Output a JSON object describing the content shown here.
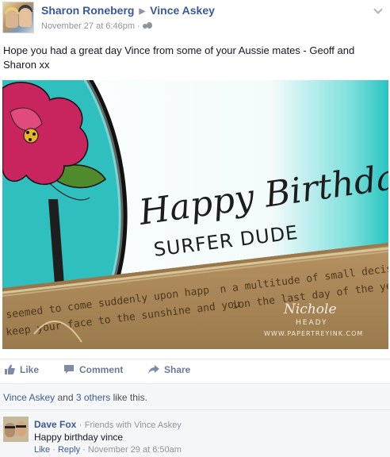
{
  "post": {
    "author": "Sharon Roneberg",
    "target": "Vince Askey",
    "timestamp": "November 27 at 6:46pm",
    "separator": "·",
    "text": "Hope you had a great day Vince from some of your Aussie mates - Geoff and Sharon xx"
  },
  "photo": {
    "card_line1": "Happy Birthday",
    "card_line2": "SURFER DUDE",
    "paper_text": [
      "seemed to come suddenly upon happ",
      "keep your face to the sunshine and you",
      "n a multitude of small decisions",
      "ion the last day of the year"
    ],
    "watermark_name": "Nichole",
    "watermark_surname": "HEADY",
    "watermark_site": "WWW.PAPERTREYINK.COM",
    "colors": {
      "teal": "#29c3c0",
      "pink": "#c8245e",
      "kraft": "#a98556",
      "moss": "#6e6b2a"
    }
  },
  "actions": {
    "like": "Like",
    "comment": "Comment",
    "share": "Share"
  },
  "likes": {
    "name": "Vince Askey",
    "and": "and",
    "others": "3 others",
    "suffix": "like this."
  },
  "comment": {
    "author": "Dave Fox",
    "separator": "·",
    "relation": "Friends with Vince Askey",
    "text": "Happy birthday vince",
    "like": "Like",
    "reply": "Reply",
    "timestamp": "November 29 at 6:50am"
  },
  "colors": {
    "link": "#3b5998",
    "meta": "#90949c",
    "action": "#6d7a94"
  }
}
